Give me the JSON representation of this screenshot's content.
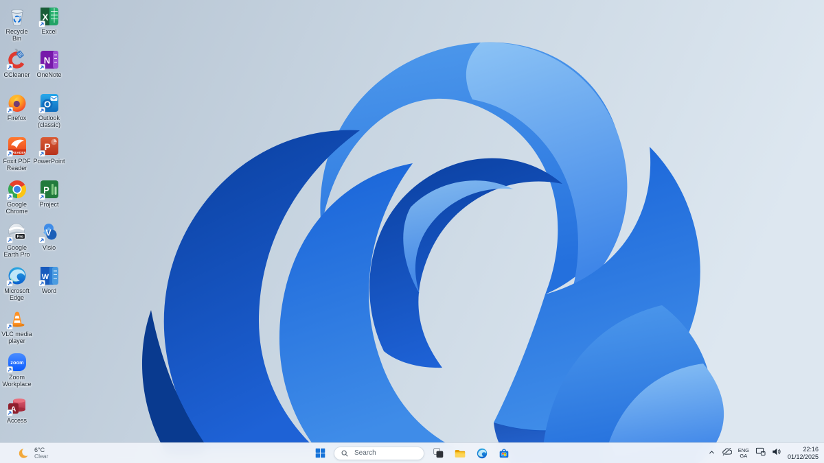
{
  "colors": {
    "taskbar_bg": "#eef3f9",
    "accent_blue": "#1572d8",
    "bloom_dark": "#0a3f9f",
    "bloom_mid": "#1e66d8",
    "bloom_light": "#4f9aec",
    "background_top_left": "#b6c4d2",
    "background_right": "#dce6ef"
  },
  "desktop": {
    "col1": [
      {
        "label": "Recycle Bin"
      },
      {
        "label": "CCleaner"
      },
      {
        "label": "Firefox"
      },
      {
        "label": "Foxit PDF Reader",
        "icon_text": "READER"
      },
      {
        "label": "Google Chrome"
      },
      {
        "label": "Google Earth Pro",
        "icon_text": "Pro"
      },
      {
        "label": "Microsoft Edge"
      },
      {
        "label": "VLC media player"
      },
      {
        "label": "Zoom Workplace",
        "icon_text": "zoom"
      },
      {
        "label": "Access",
        "icon_text": "A"
      }
    ],
    "col2": [
      {
        "label": "Excel",
        "icon_text": "X"
      },
      {
        "label": "OneNote",
        "icon_text": "N"
      },
      {
        "label": "Outlook (classic)",
        "icon_text": "O"
      },
      {
        "label": "PowerPoint",
        "icon_text": "P"
      },
      {
        "label": "Project",
        "icon_text": "P"
      },
      {
        "label": "Visio",
        "icon_text": "V"
      },
      {
        "label": "Word",
        "icon_text": "W"
      }
    ]
  },
  "taskbar": {
    "weather": {
      "temp": "6°C",
      "condition": "Clear"
    },
    "search_placeholder": "Search",
    "center_items": [
      "start",
      "search",
      "task-view",
      "file-explorer",
      "edge",
      "microsoft-store"
    ],
    "tray": {
      "language_line1": "ENG",
      "language_line2": "GA",
      "time": "22:16",
      "date": "01/12/2025"
    }
  }
}
